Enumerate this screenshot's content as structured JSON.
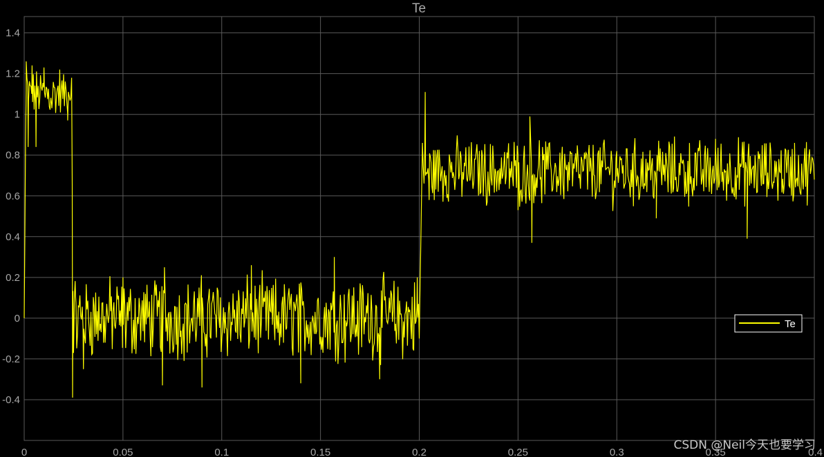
{
  "page_title": "Te",
  "watermark": "CSDN @Neil今天也要学习",
  "colors": {
    "background": "#000000",
    "plot_area": "#000000",
    "grid": "#5a5a5a",
    "axis_text": "#a8a8a8",
    "series": "#ffff00",
    "legend_border": "#ffffff"
  },
  "chart_data": {
    "type": "line",
    "title": "Te",
    "xlabel": "",
    "ylabel": "",
    "xlim": [
      0,
      0.4
    ],
    "ylim": [
      -0.6,
      1.48
    ],
    "x_ticks": [
      "0",
      "0.05",
      "0.1",
      "0.15",
      "0.2",
      "0.25",
      "0.3",
      "0.35",
      "0.4"
    ],
    "y_ticks": [
      "-0.4",
      "-0.2",
      "0",
      "0.2",
      "0.4",
      "0.6",
      "0.8",
      "1",
      "1.2",
      "1.4"
    ],
    "grid": true,
    "legend": {
      "position": "right-center",
      "entries": [
        "Te"
      ]
    },
    "series": [
      {
        "name": "Te",
        "color": "#ffff00",
        "segments": [
          {
            "x_start": 0.0,
            "x_end": 0.001,
            "mean": 0.65,
            "amplitude": 0.6
          },
          {
            "x_start": 0.001,
            "x_end": 0.024,
            "mean": 1.1,
            "amplitude": 0.15
          },
          {
            "x_start": 0.024,
            "x_end": 0.025,
            "mean": 0.4,
            "amplitude": 0.8
          },
          {
            "x_start": 0.025,
            "x_end": 0.2,
            "mean": 0.0,
            "amplitude": 0.25
          },
          {
            "x_start": 0.2,
            "x_end": 0.202,
            "mean": 0.55,
            "amplitude": 0.5
          },
          {
            "x_start": 0.202,
            "x_end": 0.4,
            "mean": 0.72,
            "amplitude": 0.2
          }
        ],
        "points": [
          [
            0.0,
            0.0
          ],
          [
            0.001,
            1.26
          ],
          [
            0.002,
            0.84
          ],
          [
            0.004,
            1.24
          ],
          [
            0.006,
            0.84
          ],
          [
            0.01,
            1.23
          ],
          [
            0.014,
            1.03
          ],
          [
            0.018,
            1.22
          ],
          [
            0.022,
            0.97
          ],
          [
            0.024,
            1.18
          ],
          [
            0.0245,
            -0.39
          ],
          [
            0.026,
            0.11
          ],
          [
            0.03,
            -0.25
          ],
          [
            0.05,
            0.2
          ],
          [
            0.07,
            -0.33
          ],
          [
            0.071,
            0.25
          ],
          [
            0.09,
            -0.34
          ],
          [
            0.115,
            0.26
          ],
          [
            0.14,
            -0.32
          ],
          [
            0.157,
            0.3
          ],
          [
            0.18,
            -0.3
          ],
          [
            0.199,
            0.2
          ],
          [
            0.2,
            -0.1
          ],
          [
            0.203,
            1.11
          ],
          [
            0.205,
            0.58
          ],
          [
            0.25,
            0.53
          ],
          [
            0.256,
            0.99
          ],
          [
            0.257,
            0.37
          ],
          [
            0.3,
            0.82
          ],
          [
            0.32,
            0.49
          ],
          [
            0.35,
            0.88
          ],
          [
            0.366,
            0.39
          ],
          [
            0.39,
            0.86
          ],
          [
            0.4,
            0.68
          ]
        ]
      }
    ]
  }
}
